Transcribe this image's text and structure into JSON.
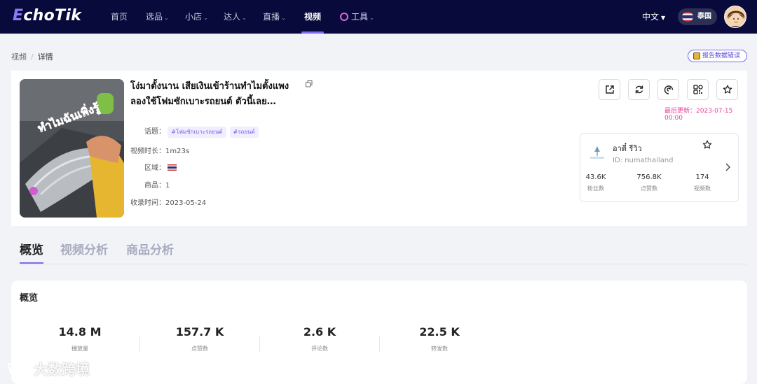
{
  "brand": {
    "logo_e": "E",
    "logo_rest": "choTik"
  },
  "nav": {
    "items": [
      {
        "label": "首页",
        "caret": false
      },
      {
        "label": "选品",
        "caret": true
      },
      {
        "label": "小店",
        "caret": true
      },
      {
        "label": "达人",
        "caret": true
      },
      {
        "label": "直播",
        "caret": true
      },
      {
        "label": "视频",
        "caret": false,
        "active": true
      },
      {
        "label": "工具",
        "caret": true
      }
    ],
    "language": "中文",
    "region": "泰国"
  },
  "breadcrumb": {
    "parent": "视频",
    "separator": "/",
    "current": "详情"
  },
  "report_button": "报告数据错误",
  "video": {
    "thumbnail_overlay_text": "ทำไมฉันเพิ่งรู้",
    "title": "โง่มาตั้งนาน เสียเงินเข้าร้านทำไมตั้งแพง ลองใช้โฟมซักเบาะรถยนต์ ตัวนี้เลย ออกแบบมาเพื่อทำความสะอาดเบาะโดยเฉพาะ",
    "topics_label": "话题：",
    "topics": [
      "#โฟมซักเบาะรถยนต์",
      "#รถยนต์"
    ],
    "duration_label": "视频时长：",
    "duration": "1m23s",
    "region_label": "区域：",
    "products_label": "商品：",
    "products": "1",
    "collected_label": "收录时间：",
    "collected": "2023-05-24",
    "last_updated_label": "最后更新：",
    "last_updated": "2023-07-15 00:00"
  },
  "actions": [
    "share-icon",
    "refresh-icon",
    "link-icon",
    "qrcode-icon",
    "star-icon"
  ],
  "author": {
    "logo_text": "Numa Thailand",
    "name": "อาตี๋ รีวิว",
    "id_label": "ID:",
    "id": "numathailand",
    "stats": [
      {
        "value": "43.6K",
        "label": "粉丝数"
      },
      {
        "value": "756.8K",
        "label": "点赞数"
      },
      {
        "value": "174",
        "label": "视频数"
      }
    ]
  },
  "tabs": [
    {
      "label": "概览",
      "active": true
    },
    {
      "label": "视频分析",
      "active": false
    },
    {
      "label": "商品分析",
      "active": false
    }
  ],
  "overview": {
    "title": "概览",
    "stats": [
      {
        "value": "14.8 M",
        "label": "播放量"
      },
      {
        "value": "157.7 K",
        "label": "点赞数"
      },
      {
        "value": "2.6 K",
        "label": "评论数"
      },
      {
        "value": "22.5 K",
        "label": "转发数"
      }
    ]
  },
  "watermark": "大数跨境",
  "colors": {
    "nav_bg": "#070a3a",
    "accent": "#7b6cf0",
    "updated_pink": "#e6469a",
    "tag_bg": "#f1efff"
  }
}
